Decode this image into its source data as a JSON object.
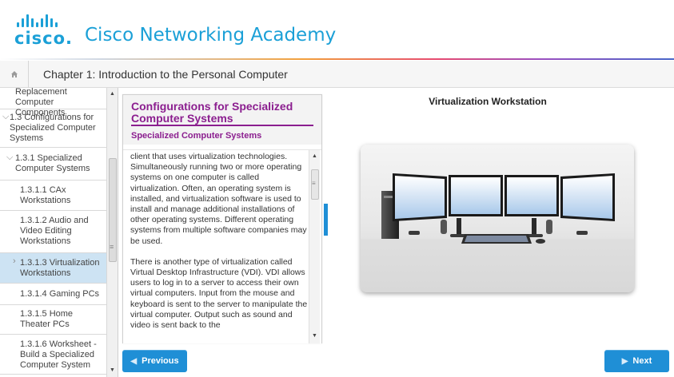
{
  "brand": {
    "logo_text": "cisco.",
    "title": "Cisco Networking Academy"
  },
  "chapter": {
    "title": "Chapter 1: Introduction to the Personal Computer"
  },
  "sidebar": {
    "items": [
      {
        "label": "Replacement Computer Components",
        "level": 3,
        "expanded": null,
        "active": false
      },
      {
        "label": "1.3 Configurations for Specialized Computer Systems",
        "level": 2,
        "expanded": true,
        "active": false
      },
      {
        "label": "1.3.1 Specialized Computer Systems",
        "level": 3,
        "expanded": true,
        "active": false
      },
      {
        "label": "1.3.1.1 CAx Workstations",
        "level": 4,
        "expanded": null,
        "active": false
      },
      {
        "label": "1.3.1.2 Audio and Video Editing Workstations",
        "level": 4,
        "expanded": null,
        "active": false
      },
      {
        "label": "1.3.1.3 Virtualization Workstations",
        "level": 4,
        "expanded": null,
        "active": true
      },
      {
        "label": "1.3.1.4 Gaming PCs",
        "level": 4,
        "expanded": null,
        "active": false
      },
      {
        "label": "1.3.1.5 Home Theater PCs",
        "level": 4,
        "expanded": null,
        "active": false
      },
      {
        "label": "1.3.1.6 Worksheet - Build a Specialized Computer System",
        "level": 4,
        "expanded": null,
        "active": false
      }
    ]
  },
  "content": {
    "title": "Configurations for Specialized Computer Systems",
    "subtitle": "Specialized Computer Systems",
    "paragraphs": [
      "client that uses virtualization technologies. Simultaneously running two or more operating systems on one computer is called virtualization. Often, an operating system is installed, and virtualization software is used to install and manage additional installations of other operating systems. Different operating systems from multiple software companies may be used.",
      "There is another type of virtualization called Virtual Desktop Infrastructure (VDI). VDI allows users to log in to a server to access their own virtual computers. Input from the mouse and keyboard is sent to the server to manipulate the virtual computer. Output such as sound and video is sent back to the"
    ]
  },
  "media": {
    "title": "Virtualization Workstation",
    "image_subject": "four-monitor-workstation-photo"
  },
  "navigation": {
    "previous_label": "Previous",
    "next_label": "Next"
  },
  "colors": {
    "brand_blue": "#1ba0d7",
    "heading_purple": "#8b1e8f",
    "button_blue": "#1f8fd6",
    "active_nav": "#cde3f3"
  }
}
